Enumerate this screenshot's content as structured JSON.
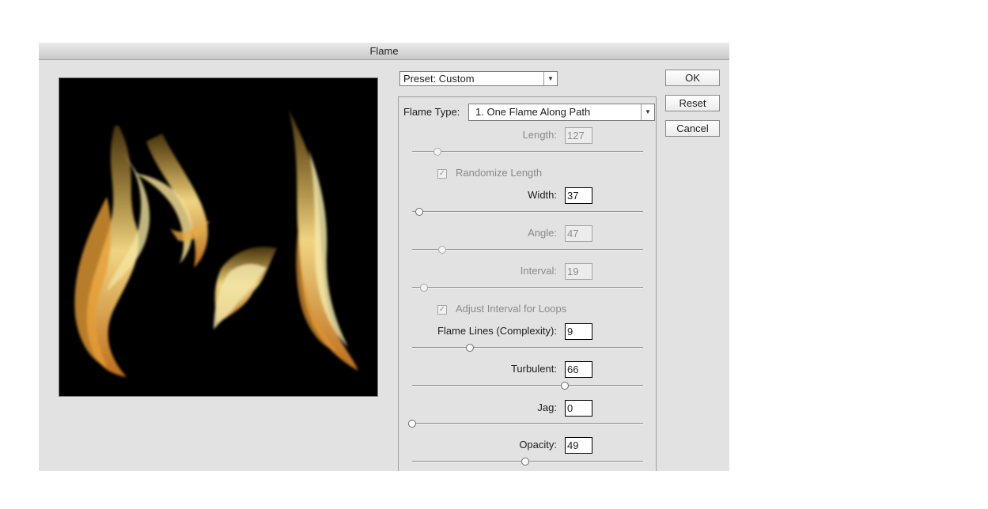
{
  "dialog": {
    "title": "Flame"
  },
  "preset": {
    "value": "Preset: Custom"
  },
  "buttons": {
    "ok": "OK",
    "reset": "Reset",
    "cancel": "Cancel"
  },
  "flame_type": {
    "label": "Flame Type:",
    "value": "1. One Flame Along Path"
  },
  "controls": {
    "length": {
      "label": "Length:",
      "value": "127",
      "enabled": false
    },
    "randomize_length": {
      "label": "Randomize Length",
      "checked": true,
      "enabled": false
    },
    "width": {
      "label": "Width:",
      "value": "37",
      "enabled": true
    },
    "angle": {
      "label": "Angle:",
      "value": "47",
      "enabled": false
    },
    "interval": {
      "label": "Interval:",
      "value": "19",
      "enabled": false
    },
    "adjust_interval": {
      "label": "Adjust Interval for Loops",
      "checked": true,
      "enabled": false
    },
    "complexity": {
      "label": "Flame Lines (Complexity):",
      "value": "9",
      "enabled": true
    },
    "turbulent": {
      "label": "Turbulent:",
      "value": "66",
      "enabled": true
    },
    "jag": {
      "label": "Jag:",
      "value": "0",
      "enabled": true
    },
    "opacity": {
      "label": "Opacity:",
      "value": "49",
      "enabled": true
    }
  },
  "sliders": {
    "length": 0.11,
    "width": 0.03,
    "angle": 0.13,
    "interval": 0.05,
    "complexity": 0.25,
    "turbulent": 0.66,
    "jag": 0.0,
    "opacity": 0.49
  },
  "colors": {
    "flame_core": "#fff3b0",
    "flame_mid": "#f6b73c",
    "flame_edge": "#b8621a"
  }
}
